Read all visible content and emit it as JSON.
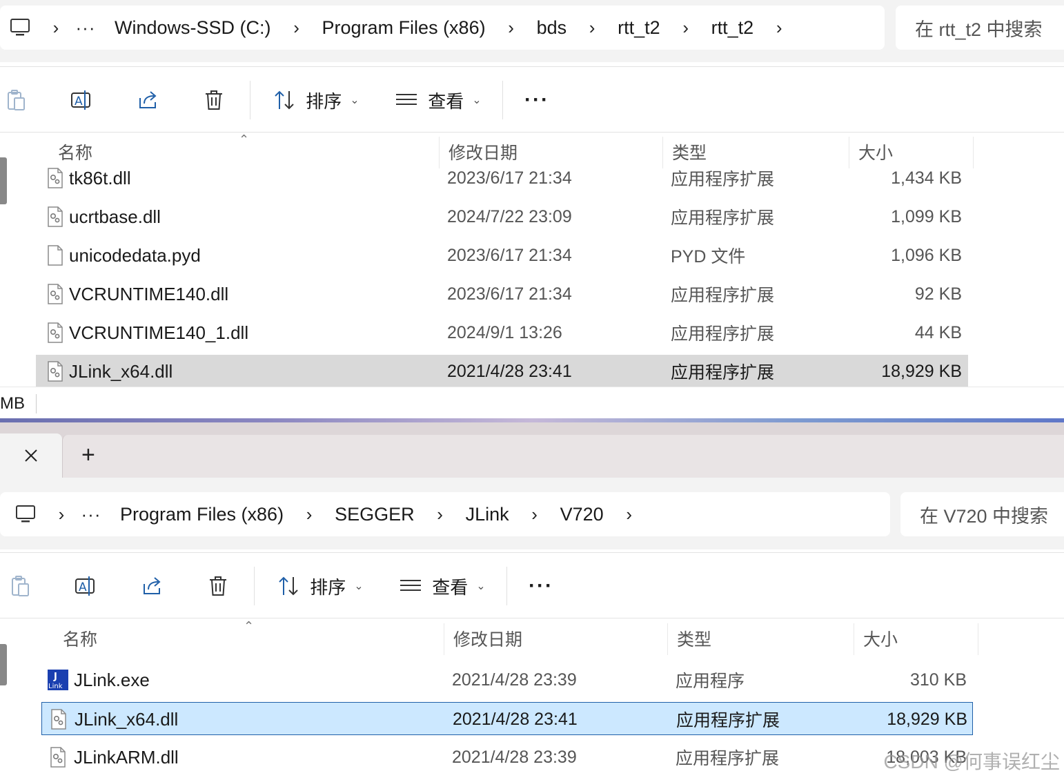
{
  "window1": {
    "breadcrumbs": [
      "Windows-SSD (C:)",
      "Program Files (x86)",
      "bds",
      "rtt_t2",
      "rtt_t2"
    ],
    "more": "···",
    "search_placeholder": "在 rtt_t2 中搜索",
    "toolbar": {
      "sort_label": "排序",
      "view_label": "查看",
      "more": "···"
    },
    "columns": {
      "name": "名称",
      "date": "修改日期",
      "type": "类型",
      "size": "大小"
    },
    "files": [
      {
        "name": "tk86t.dll",
        "date": "2023/6/17 21:34",
        "type": "应用程序扩展",
        "size": "1,434 KB",
        "icon": "dll-file-icon"
      },
      {
        "name": "ucrtbase.dll",
        "date": "2024/7/22 23:09",
        "type": "应用程序扩展",
        "size": "1,099 KB",
        "icon": "dll-file-icon"
      },
      {
        "name": "unicodedata.pyd",
        "date": "2023/6/17 21:34",
        "type": "PYD 文件",
        "size": "1,096 KB",
        "icon": "blank-file-icon"
      },
      {
        "name": "VCRUNTIME140.dll",
        "date": "2023/6/17 21:34",
        "type": "应用程序扩展",
        "size": "92 KB",
        "icon": "dll-file-icon"
      },
      {
        "name": "VCRUNTIME140_1.dll",
        "date": "2024/9/1 13:26",
        "type": "应用程序扩展",
        "size": "44 KB",
        "icon": "dll-file-icon"
      },
      {
        "name": "JLink_x64.dll",
        "date": "2021/4/28 23:41",
        "type": "应用程序扩展",
        "size": "18,929 KB",
        "icon": "dll-file-icon",
        "selected": true
      }
    ],
    "status_text": "MB"
  },
  "window2": {
    "breadcrumbs": [
      "Program Files (x86)",
      "SEGGER",
      "JLink",
      "V720"
    ],
    "more": "···",
    "search_placeholder": "在 V720 中搜索",
    "toolbar": {
      "sort_label": "排序",
      "view_label": "查看",
      "more": "···"
    },
    "columns": {
      "name": "名称",
      "date": "修改日期",
      "type": "类型",
      "size": "大小"
    },
    "files": [
      {
        "name": "JLink.exe",
        "date": "2021/4/28 23:39",
        "type": "应用程序",
        "size": "310 KB",
        "icon": "jlink-app-icon"
      },
      {
        "name": "JLink_x64.dll",
        "date": "2021/4/28 23:41",
        "type": "应用程序扩展",
        "size": "18,929 KB",
        "icon": "dll-file-icon",
        "selected": true
      },
      {
        "name": "JLinkARM.dll",
        "date": "2021/4/28 23:39",
        "type": "应用程序扩展",
        "size": "18,003 KB",
        "icon": "dll-file-icon"
      }
    ],
    "tab_new": "+"
  },
  "watermark": "CSDN @何事误红尘",
  "colors": {
    "grey_selection": "#d9d9d9",
    "blue_selection": "#cce8ff",
    "selection_border": "#1f5fa8",
    "accent": "#1f5fa8"
  }
}
